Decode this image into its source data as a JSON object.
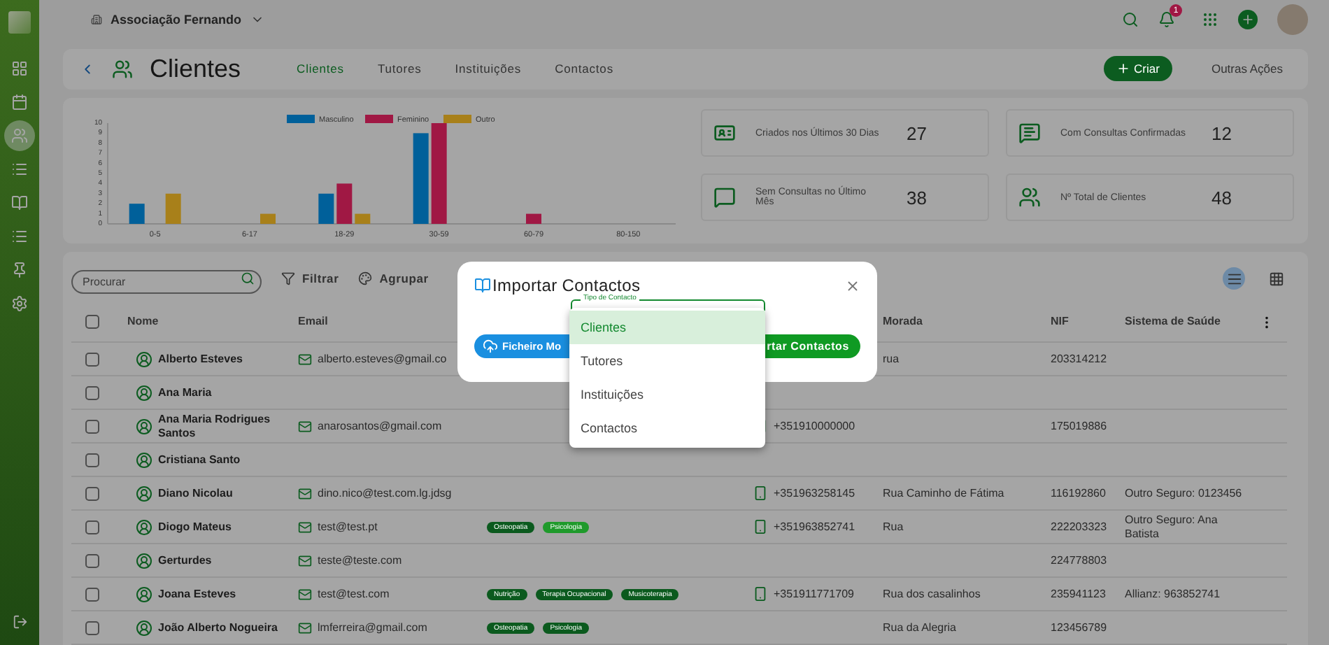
{
  "sidebar": {
    "items": [
      {
        "kind": "dashboard",
        "selected": false
      },
      {
        "kind": "calendar",
        "selected": false
      },
      {
        "kind": "clients",
        "selected": true
      },
      {
        "kind": "list",
        "selected": false
      },
      {
        "kind": "book",
        "selected": false
      },
      {
        "kind": "list",
        "selected": false
      },
      {
        "kind": "pin",
        "selected": false
      },
      {
        "kind": "settings",
        "selected": false
      }
    ]
  },
  "topbar": {
    "organization": "Associação Fernando",
    "notifications_badge": "1"
  },
  "header": {
    "title": "Clientes",
    "tabs": [
      {
        "label": "Clientes",
        "selected": true
      },
      {
        "label": "Tutores",
        "selected": false
      },
      {
        "label": "Instituições",
        "selected": false
      },
      {
        "label": "Contactos",
        "selected": false
      }
    ],
    "create_button": "Criar",
    "more_actions": "Outras Ações"
  },
  "stats": {
    "chart_data": {
      "type": "bar",
      "categories": [
        "0-5",
        "6-17",
        "18-29",
        "30-59",
        "60-79",
        "80-150"
      ],
      "ylim": [
        0,
        10
      ],
      "yticks": [
        0,
        1,
        2,
        3,
        4,
        5,
        6,
        7,
        8,
        9,
        10
      ],
      "legend": "top",
      "series": [
        {
          "name": "Masculino",
          "color": "#00609a",
          "values": [
            2,
            0,
            3,
            9,
            0,
            0
          ]
        },
        {
          "name": "Feminino",
          "color": "#a01844",
          "values": [
            0,
            0,
            4,
            10,
            1,
            0
          ]
        },
        {
          "name": "Outro",
          "color": "#a8801a",
          "values": [
            3,
            1,
            1,
            0,
            0,
            0
          ]
        }
      ]
    },
    "cards": [
      {
        "kind": "id",
        "label": "Criados nos Últimos 30 Dias",
        "value": "27"
      },
      {
        "kind": "message",
        "label": "Com Consultas Confirmadas",
        "value": "12"
      },
      {
        "kind": "chat",
        "label": "Sem Consultas no Último Mês",
        "value": "38"
      },
      {
        "kind": "people",
        "label": "Nº Total de Clientes",
        "value": "48"
      }
    ]
  },
  "table": {
    "search": {
      "placeholder": "Procurar"
    },
    "filter": "Filtrar",
    "group": "Agrupar",
    "view_modes": [
      {
        "kind": "list",
        "selected": true
      },
      {
        "kind": "grid",
        "selected": false
      }
    ],
    "select_all_checked": false,
    "columns": {
      "name": "Nome",
      "email": "Email",
      "address": "Morada",
      "nif": "NIF",
      "health_system": "Sistema de Saúde"
    },
    "rows": [
      {
        "checked": false,
        "name": "Alberto Esteves",
        "email": "alberto.esteves@gmail.co",
        "address": "rua",
        "nif": "203314212"
      },
      {
        "checked": false,
        "name": "Ana Maria"
      },
      {
        "checked": false,
        "name": "Ana Maria Rodrigues Santos",
        "email": "anarosantos@gmail.com",
        "phone": "+351910000000",
        "nif": "175019886"
      },
      {
        "checked": false,
        "name": "Cristiana Santo"
      },
      {
        "checked": false,
        "name": "Diano Nicolau",
        "email": "dino.nico@test.com.lg.jdsg",
        "phone": "+351963258145",
        "address": "Rua Caminho de Fátima",
        "nif": "116192860",
        "health_system": "Outro Seguro: 0123456"
      },
      {
        "checked": false,
        "name": "Diogo Mateus",
        "email": "test@test.pt",
        "tags": [
          {
            "label": "Osteopatia",
            "color": "#0b5a1e"
          },
          {
            "label": "Psicologia",
            "color": "#1f9a2b"
          }
        ],
        "phone": "+351963852741",
        "address": "Rua",
        "nif": "222203323",
        "health_system": "Outro Seguro: Ana Batista"
      },
      {
        "checked": false,
        "name": "Gerturdes",
        "email": "teste@teste.com",
        "nif": "224778803"
      },
      {
        "checked": false,
        "name": "Joana Esteves",
        "email": "test@test.com",
        "tags": [
          {
            "label": "Nutrição",
            "color": "#0b5a1e"
          },
          {
            "label": "Terapia Ocupacional",
            "color": "#0b5a1e"
          },
          {
            "label": "Musicoterapia",
            "color": "#0b5a1e"
          }
        ],
        "phone": "+351911771709",
        "address": "Rua dos casalinhos",
        "nif": "235941123",
        "health_system": "Allianz: 963852741"
      },
      {
        "checked": false,
        "name": "João Alberto Nogueira",
        "email": "lmferreira@gmail.com",
        "tags": [
          {
            "label": "Osteopatia",
            "color": "#0b5a1e"
          },
          {
            "label": "Psicologia",
            "color": "#0b5a1e"
          }
        ],
        "address": "Rua da Alegria",
        "nif": "123456789"
      }
    ]
  },
  "modal": {
    "title": "Importar Contactos",
    "field_label": "Tipo de Contacto",
    "template_button": "Ficheiro Mo",
    "import_button": "rtar Contactos",
    "options": [
      {
        "label": "Clientes",
        "selected": true
      },
      {
        "label": "Tutores",
        "selected": false
      },
      {
        "label": "Instituições",
        "selected": false
      },
      {
        "label": "Contactos",
        "selected": false
      }
    ]
  }
}
